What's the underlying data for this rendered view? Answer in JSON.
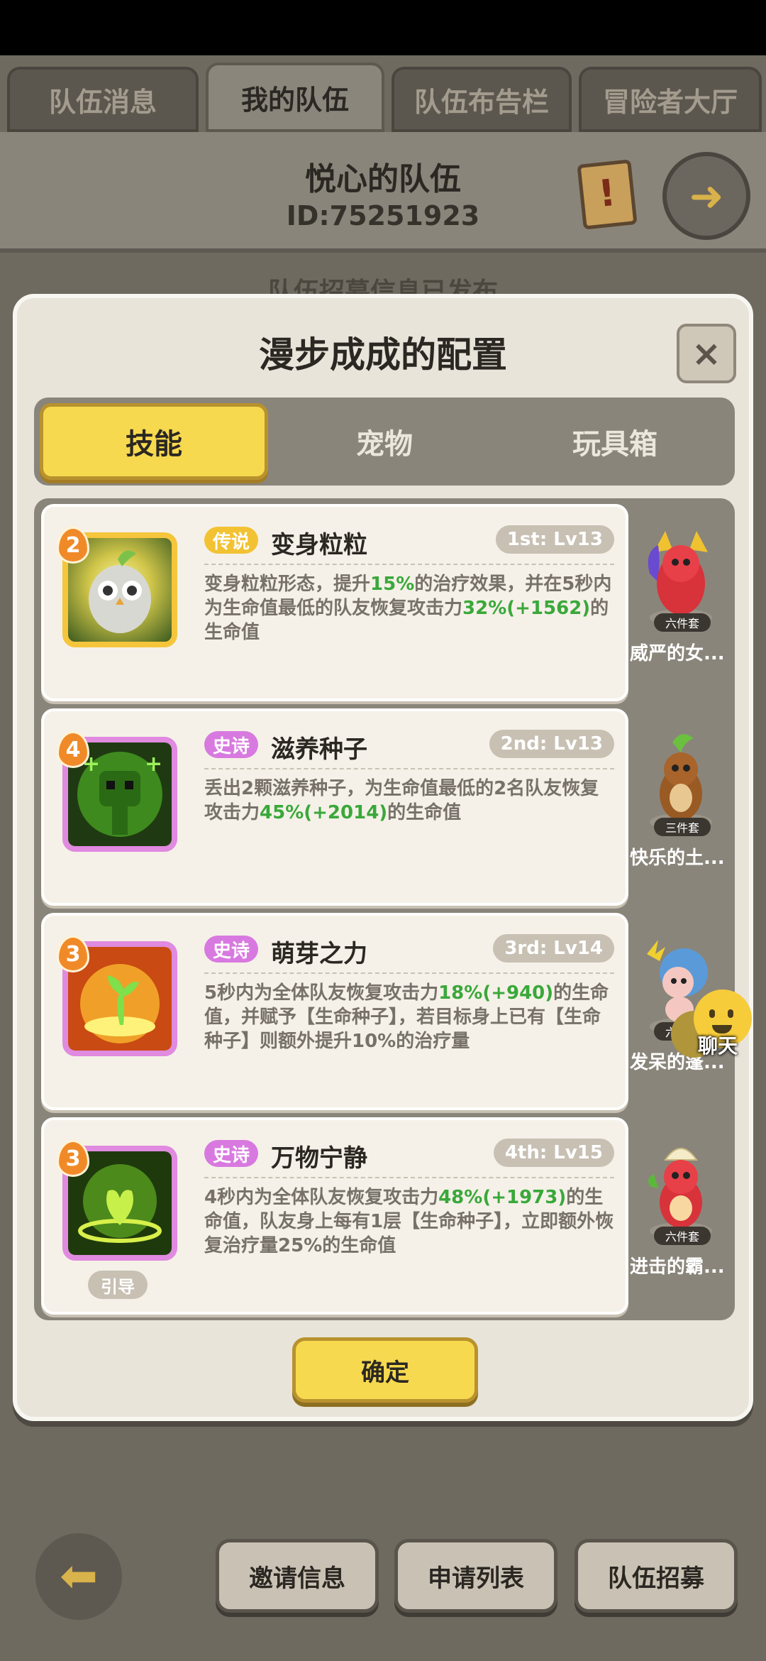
{
  "top_tabs": [
    "队伍消息",
    "我的队伍",
    "队伍布告栏",
    "冒险者大厅"
  ],
  "team": {
    "name": "悦心的队伍",
    "id": "ID:75251923"
  },
  "notice": "队伍招募信息已发布",
  "modal": {
    "title": "漫步成成的配置",
    "close": "×",
    "tabs": [
      "技能",
      "宠物",
      "玩具箱"
    ],
    "skills": [
      {
        "badge": "2",
        "rarity": "传说",
        "name": "变身粒粒",
        "slot": "1st: Lv13",
        "desc": [
          {
            "t": "变身粒粒形态，提升"
          },
          {
            "t": "15%",
            "g": true
          },
          {
            "t": "的治疗效果，并在5秒内为生命值最低的队友恢复攻击力"
          },
          {
            "t": "32%(+1562)",
            "g": true
          },
          {
            "t": "的生命值"
          }
        ]
      },
      {
        "badge": "4",
        "rarity": "史诗",
        "name": "滋养种子",
        "slot": "2nd: Lv13",
        "desc": [
          {
            "t": "丢出2颗滋养种子，为生命值最低的2名队友恢复攻击力"
          },
          {
            "t": "45%(+2014)",
            "g": true
          },
          {
            "t": "的生命值"
          }
        ]
      },
      {
        "badge": "3",
        "rarity": "史诗",
        "name": "萌芽之力",
        "slot": "3rd: Lv14",
        "desc": [
          {
            "t": "5秒内为全体队友恢复攻击力"
          },
          {
            "t": "18%(+940)",
            "g": true
          },
          {
            "t": "的生命值，并赋予【生命种子】，若目标身上已有【生命种子】则额外提升10%的治疗量"
          }
        ]
      },
      {
        "badge": "3",
        "rarity": "史诗",
        "name": "万物宁静",
        "slot": "4th: Lv15",
        "tag": "引导",
        "desc": [
          {
            "t": "4秒内为全体队友恢复攻击力"
          },
          {
            "t": "48%(+1973)",
            "g": true
          },
          {
            "t": "的生命值，队友身上每有1层【生命种子】，立即额外恢复治疗量25%的生命值"
          }
        ]
      }
    ],
    "pets": [
      {
        "set": "六件套",
        "name": "威严的女..."
      },
      {
        "set": "三件套",
        "name": "快乐的土..."
      },
      {
        "set": "六件套",
        "name": "发呆的蓬..."
      },
      {
        "set": "六件套",
        "name": "进击的霸..."
      }
    ],
    "confirm": "确定"
  },
  "chat": "聊天",
  "bottom": {
    "invite": "邀请信息",
    "apply": "申请列表",
    "recruit": "队伍招募"
  }
}
